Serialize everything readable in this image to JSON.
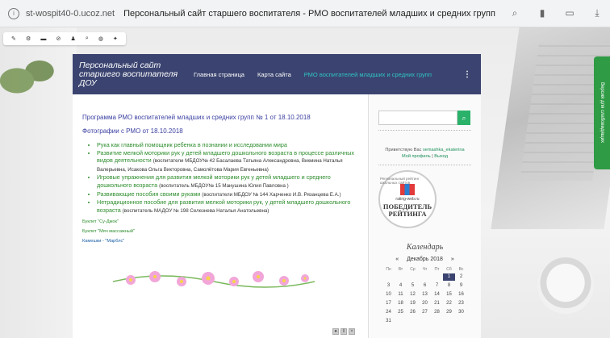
{
  "browser": {
    "url": "st-wospit40-0.ucoz.net",
    "title": "Персональный сайт старшего воспитателя - РМО воспитателей младших и средних групп",
    "icons": [
      "search-icon",
      "bookmark-icon",
      "battery-icon",
      "download-icon"
    ]
  },
  "header": {
    "site_title": "Персональный сайт старшего воспитателя ДОУ",
    "nav": [
      {
        "label": "Главная страница"
      },
      {
        "label": "Карта сайта"
      },
      {
        "label": "РМО воспитателей младших и средних групп"
      }
    ],
    "menu_icon": "⋮"
  },
  "content": {
    "heading": "Программа РМО воспитателей младших и средних групп № 1 от 18.10.2018",
    "photos": "Фотографии с РМО от 18.10.2018",
    "items": [
      {
        "text": "Рука как главный помощник ребенка в познании и исследовании мира",
        "note": ""
      },
      {
        "text": "Развитие мелкой моторики рук у детей младшего дошкольного возраста в процессе различных видов деятельности",
        "note": "(воспитатели МБДОУ№ 42 Басалаева Татьяна Александровна, Викмина Наталья Валерьевна, Исакова Ольга Викторовна, Самолётова Мария Евгеньевна)"
      },
      {
        "text": "Игровые упражнения для развития мелкой моторики рук у детей младшего и среднего дошкольного возраста",
        "note": "(воспитатель МБДОУ№ 15 Манушина Юлия Павловна )"
      },
      {
        "text": "Развивающие пособия своими руками",
        "note": "(воспитатели МБДОУ № 144 Харченко И.В. Рязанцева Е.А.)"
      },
      {
        "text": "Нетрадиционное пособие для  развития мелкой моторики  рук, у детей младшего дошкольного возраста",
        "note": "(воспитатель МАДОУ № 198 Селезнева Наталья Анатольевна)"
      }
    ],
    "booklets": [
      "Буклет \"Су-Джок\"",
      "Буклет \"Мяч массажный\"",
      "Камешки - \"Марблс\""
    ]
  },
  "sidebar": {
    "greeting": "Приветствую Вас",
    "username": "semashka_ekaterina",
    "profile_link": "Мой профиль",
    "logout_link": "Выход",
    "badge_top": "Региональный рейтинг школьных сайтов",
    "badge_site": "rating-web.ru",
    "badge_winner": "ПОБЕДИТЕЛЬ РЕЙТИНГА",
    "calendar_title": "Календарь",
    "month": "Декабрь 2018",
    "prev": "«",
    "next": "»",
    "dow": [
      "Пн",
      "Вт",
      "Ср",
      "Чт",
      "Пт",
      "Сб",
      "Вс"
    ],
    "days": [
      "",
      "",
      "",
      "",
      "",
      "1",
      "2",
      "3",
      "4",
      "5",
      "6",
      "7",
      "8",
      "9",
      "10",
      "11",
      "12",
      "13",
      "14",
      "15",
      "16",
      "17",
      "18",
      "19",
      "20",
      "21",
      "22",
      "23",
      "24",
      "25",
      "26",
      "27",
      "28",
      "29",
      "30",
      "31"
    ],
    "today": "1"
  },
  "vision_tab": "Версия для слабовидящих"
}
